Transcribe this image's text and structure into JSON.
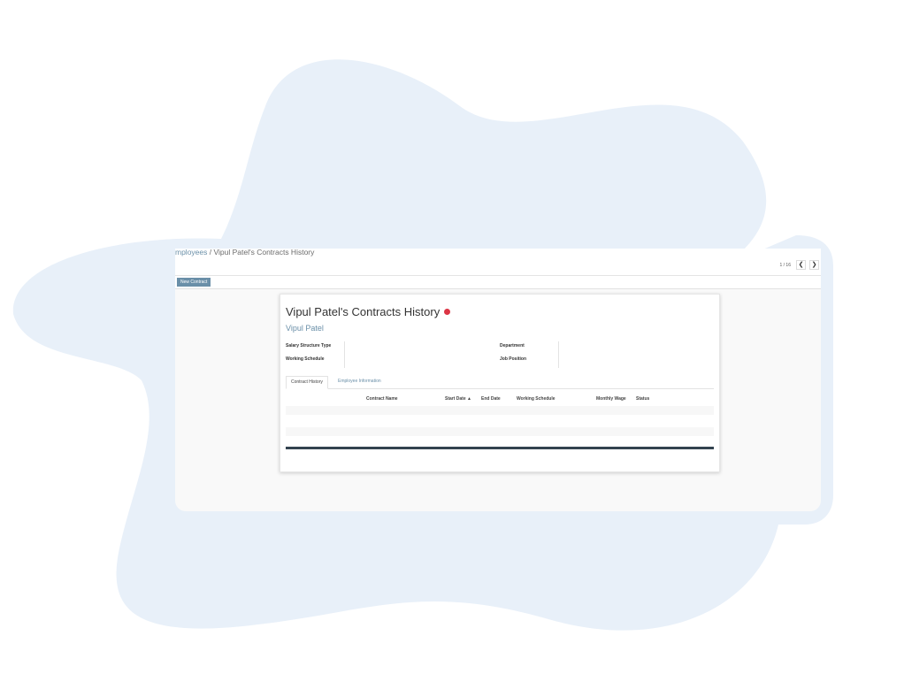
{
  "breadcrumb": {
    "parent": "mployees",
    "separator": " / ",
    "current": "Vipul Patel's Contracts History"
  },
  "pager": {
    "value": "1 / 16",
    "prev_icon": "chevron-left-icon",
    "next_icon": "chevron-right-icon"
  },
  "controls": {
    "new_button": "New Contract"
  },
  "form": {
    "title": "Vipul Patel's Contracts History",
    "employee": "Vipul Patel",
    "fields": {
      "salary_structure_type": "Salary Structure Type",
      "working_schedule": "Working Schedule",
      "department": "Department",
      "job_position": "Job Position"
    },
    "tabs": [
      "Contract History",
      "Employee Information"
    ],
    "table": {
      "columns": [
        "Contract Name",
        "Start Date ▲",
        "End Date",
        "Working Schedule",
        "Monthly Wage",
        "Status"
      ]
    }
  },
  "colors": {
    "accent": "#6a8fa8",
    "status_dot": "#dc3545",
    "blob": "#e8f0f9",
    "footer_bar": "#33434f"
  }
}
